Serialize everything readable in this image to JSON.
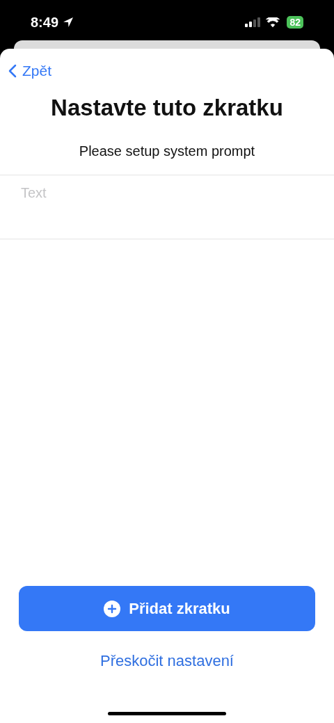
{
  "status_bar": {
    "time": "8:49",
    "battery": "82"
  },
  "nav": {
    "back": "Zpět"
  },
  "title": "Nastavte tuto zkratku",
  "subtitle": "Please setup system prompt",
  "field": {
    "placeholder": "Text"
  },
  "primary_button": "Přidat zkratku",
  "secondary_link": "Přeskočit nastavení"
}
